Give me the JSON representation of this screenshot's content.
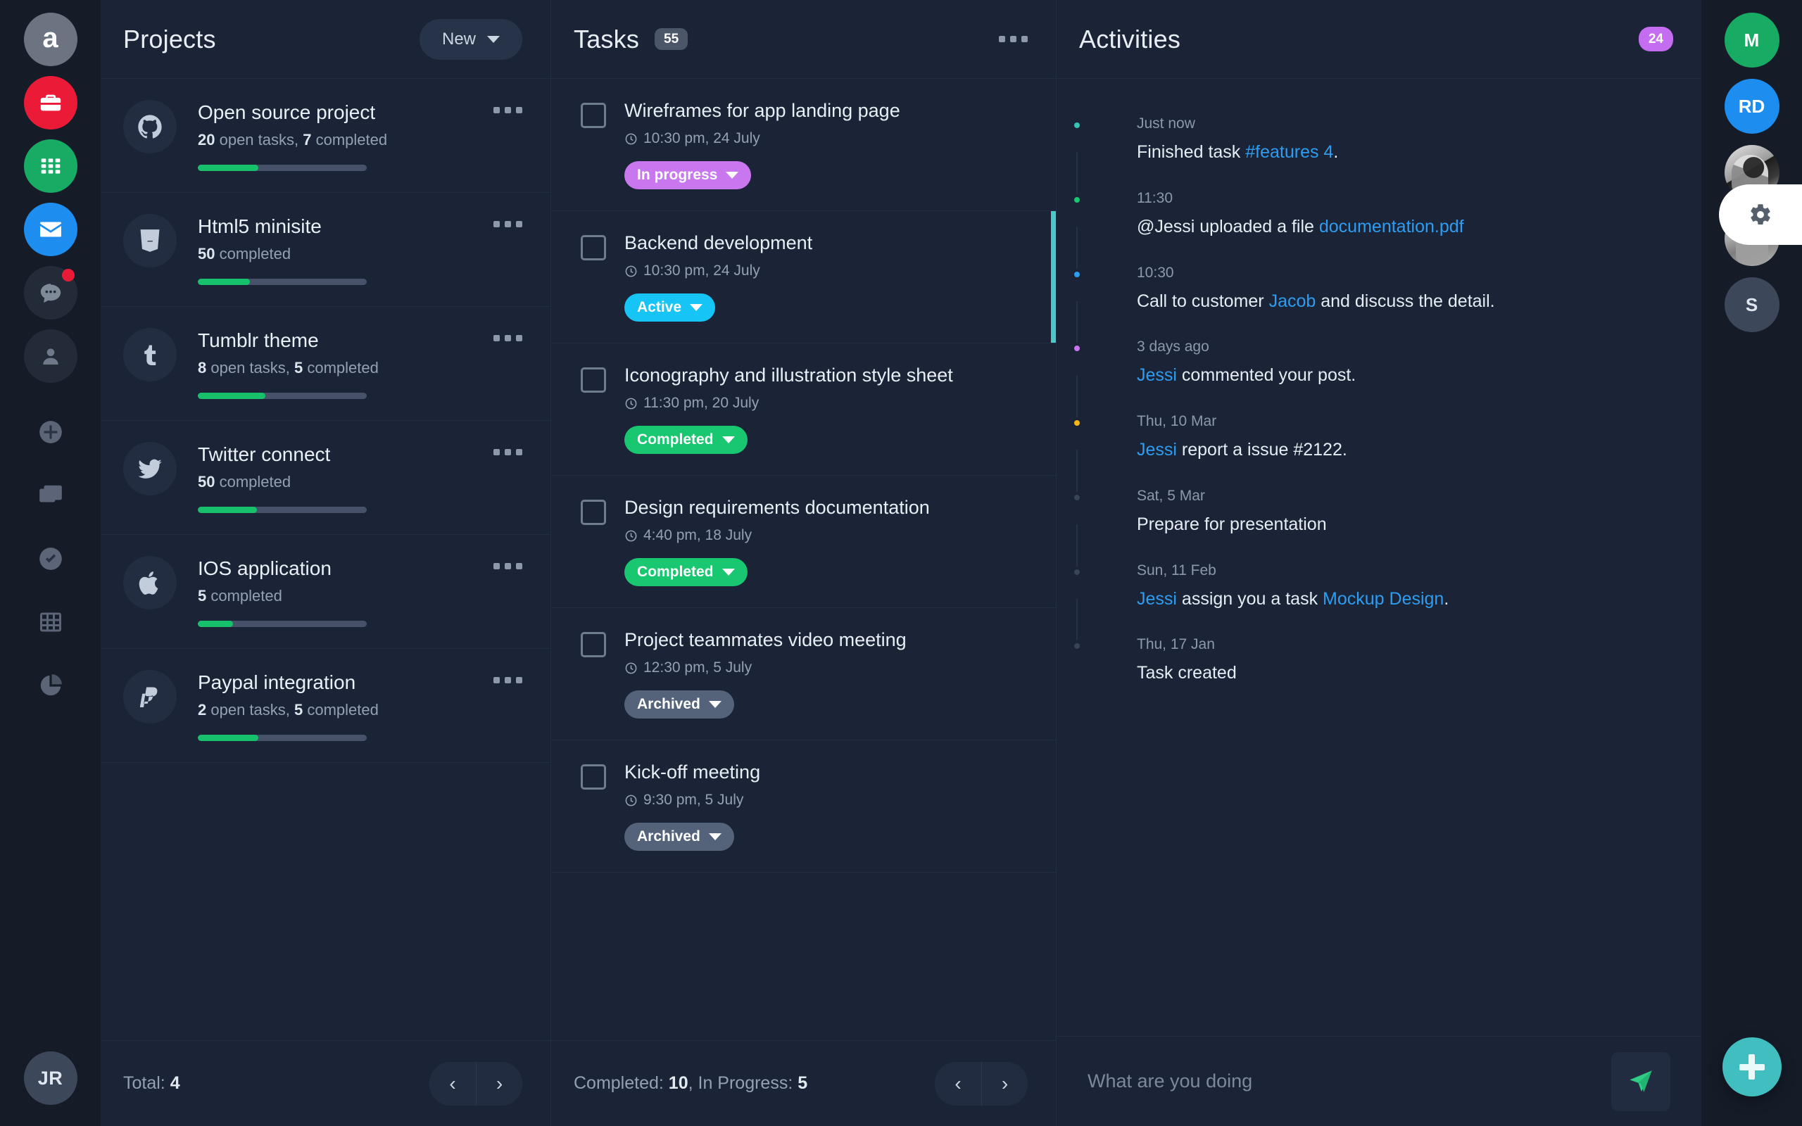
{
  "left_rail": {
    "logo_letter": "a",
    "items": [
      {
        "name": "briefcase-icon",
        "color": "#eb1b38"
      },
      {
        "name": "apps-grid-icon",
        "color": "#17ab63"
      },
      {
        "name": "mail-icon",
        "color": "#1d8ef0"
      },
      {
        "name": "chat-icon",
        "color": "#232b39",
        "badge": true
      },
      {
        "name": "user-icon",
        "color": "#232b39"
      },
      {
        "name": "add-circle-icon",
        "color": "transparent"
      },
      {
        "name": "layers-icon",
        "color": "transparent"
      },
      {
        "name": "check-circle-icon",
        "color": "transparent"
      },
      {
        "name": "table-icon",
        "color": "transparent"
      },
      {
        "name": "pie-chart-icon",
        "color": "transparent"
      }
    ],
    "bottom_avatar": "JR"
  },
  "projects": {
    "title": "Projects",
    "new_button": "New",
    "footer_label": "Total:",
    "footer_value": "4",
    "items": [
      {
        "icon": "github-icon",
        "name": "Open source project",
        "meta_open": "20",
        "meta_open_label": " open tasks, ",
        "meta_done": "7",
        "meta_done_label": " completed",
        "progress": 36
      },
      {
        "icon": "html5-icon",
        "name": "Html5 minisite",
        "meta_open": "",
        "meta_open_label": "",
        "meta_done": "50",
        "meta_done_label": " completed",
        "progress": 31
      },
      {
        "icon": "tumblr-icon",
        "name": "Tumblr theme",
        "meta_open": "8",
        "meta_open_label": " open tasks, ",
        "meta_done": "5",
        "meta_done_label": " completed",
        "progress": 40
      },
      {
        "icon": "twitter-icon",
        "name": "Twitter connect",
        "meta_open": "",
        "meta_open_label": "",
        "meta_done": "50",
        "meta_done_label": " completed",
        "progress": 35
      },
      {
        "icon": "apple-icon",
        "name": "IOS application",
        "meta_open": "",
        "meta_open_label": "",
        "meta_done": "5",
        "meta_done_label": " completed",
        "progress": 21
      },
      {
        "icon": "paypal-icon",
        "name": "Paypal integration",
        "meta_open": "2",
        "meta_open_label": " open tasks, ",
        "meta_done": "5",
        "meta_done_label": " completed",
        "progress": 36
      }
    ]
  },
  "tasks": {
    "title": "Tasks",
    "count": "55",
    "footer_completed_label": "Completed: ",
    "footer_completed_value": "10",
    "footer_inprogress_label": ", In Progress: ",
    "footer_inprogress_value": "5",
    "items": [
      {
        "name": "Wireframes for app landing page",
        "time": "10:30 pm, 24 July",
        "status": "In progress",
        "status_kind": "inprogress",
        "active": false
      },
      {
        "name": "Backend development",
        "time": "10:30 pm, 24 July",
        "status": "Active",
        "status_kind": "active",
        "active": true
      },
      {
        "name": "Iconography and illustration style sheet",
        "time": "11:30 pm, 20 July",
        "status": "Completed",
        "status_kind": "completed",
        "active": false
      },
      {
        "name": "Design requirements documentation",
        "time": "4:40 pm, 18 July",
        "status": "Completed",
        "status_kind": "completed",
        "active": false
      },
      {
        "name": "Project teammates video meeting",
        "time": "12:30 pm, 5 July",
        "status": "Archived",
        "status_kind": "archived",
        "active": false
      },
      {
        "name": "Kick-off meeting",
        "time": "9:30 pm, 5 July",
        "status": "Archived",
        "status_kind": "archived",
        "active": false
      }
    ]
  },
  "activities": {
    "title": "Activities",
    "count": "24",
    "input_placeholder": "What are you doing",
    "send_icon": "send-plane-icon",
    "items": [
      {
        "time": "Just now",
        "bullet": "#35c4b5",
        "pre": "Finished task ",
        "link": "#features 4",
        "post": "."
      },
      {
        "time": "11:30",
        "bullet": "#18c770",
        "pre": "@Jessi uploaded a file ",
        "link": "documentation.pdf",
        "post": ""
      },
      {
        "time": "10:30",
        "bullet": "#2e9cf0",
        "pre": "Call to customer ",
        "link": "Jacob",
        "post": " and discuss the detail."
      },
      {
        "time": "3 days ago",
        "bullet": "#c877ef",
        "pre": "",
        "link": "Jessi",
        "post": " commented your post."
      },
      {
        "time": "Thu, 10 Mar",
        "bullet": "#f5b711",
        "pre": "",
        "link": "Jessi",
        "post": " report a issue #2122."
      },
      {
        "time": "Sat, 5 Mar",
        "bullet": "#3a4considered",
        "pre": "Prepare for presentation",
        "link": "",
        "post": ""
      },
      {
        "time": "Sun, 11 Feb",
        "bullet": "#3a4458",
        "pre": "",
        "link": "Jessi",
        "post": " assign you a task ",
        "link2": "Mockup Design",
        "post2": "."
      },
      {
        "time": "Thu, 17 Jan",
        "bullet": "#3a4458",
        "pre": "Task created",
        "link": "",
        "post": ""
      }
    ]
  },
  "right_rail": {
    "avatars": [
      {
        "label": "M",
        "kind": "green"
      },
      {
        "label": "RD",
        "kind": "blue"
      },
      {
        "label": "",
        "kind": "photo1"
      },
      {
        "label": "",
        "kind": "photo2"
      },
      {
        "label": "S",
        "kind": "grey"
      }
    ],
    "gear_icon": "gear-icon",
    "fab_icon": "plus-icon"
  },
  "pager": {
    "prev": "‹",
    "next": "›"
  }
}
